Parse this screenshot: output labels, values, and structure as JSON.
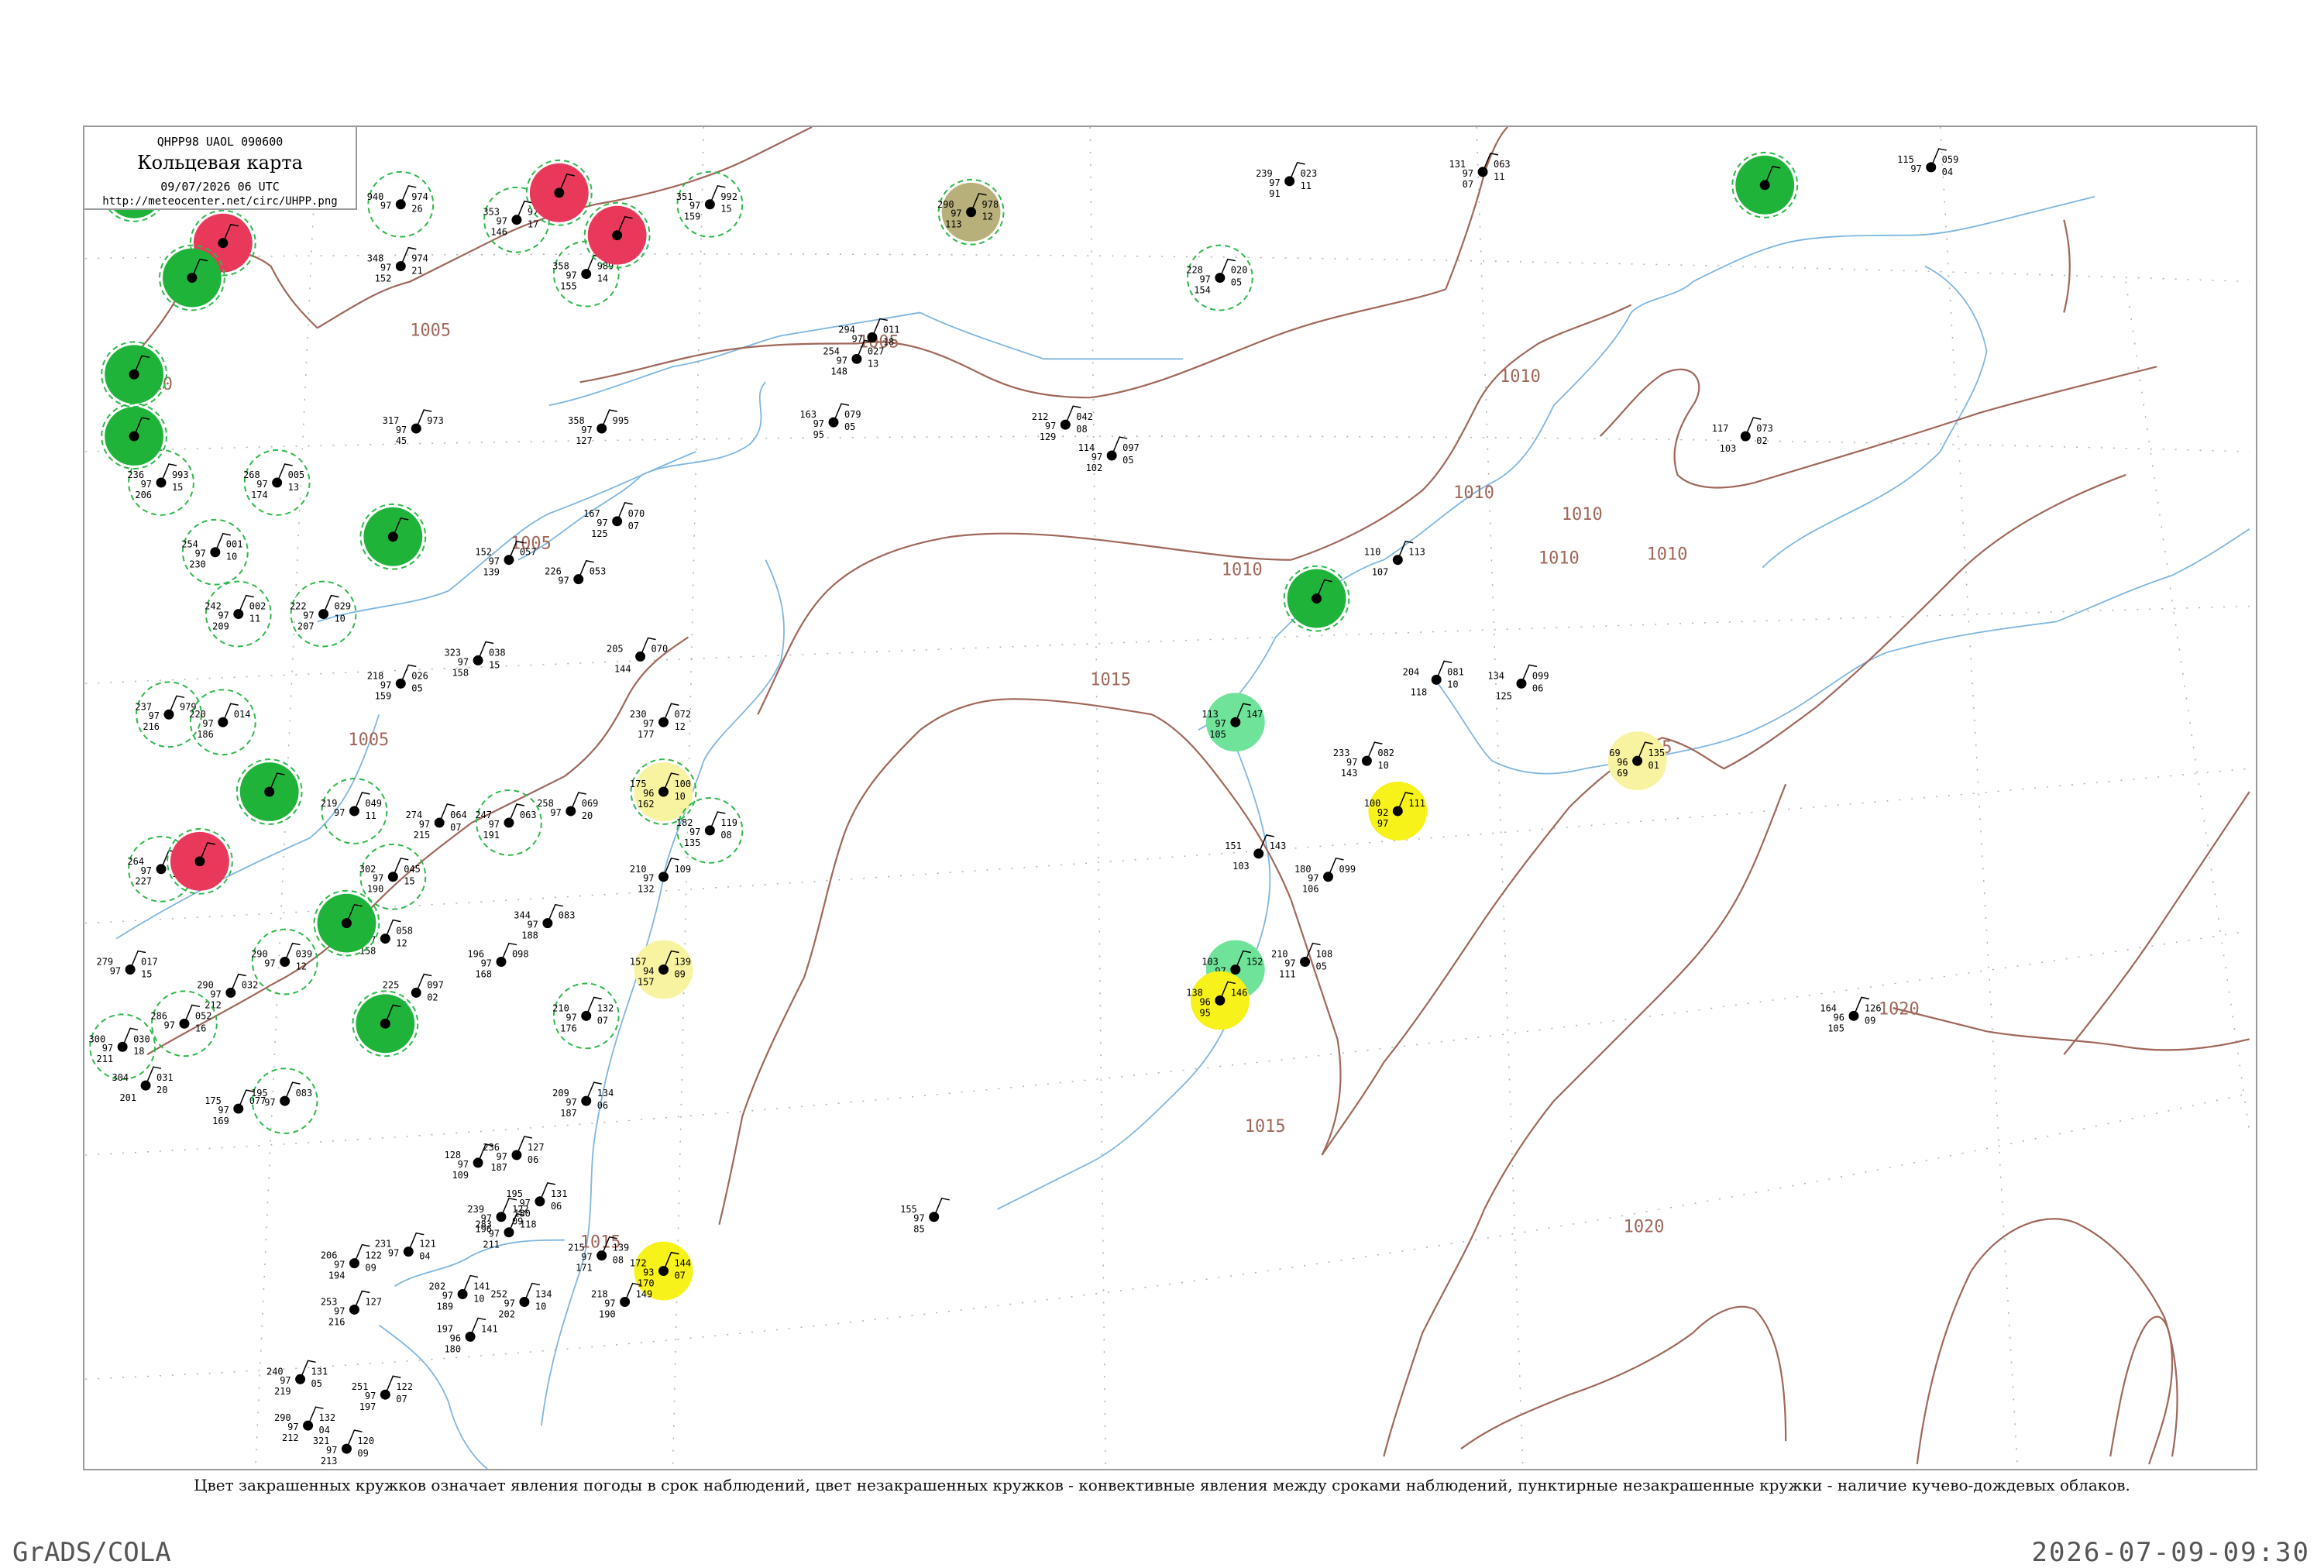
{
  "header": {
    "code": "QHPP98  UAOL  090600",
    "title": "Кольцевая карта",
    "time": "09/07/2026 06 UTC",
    "url": "http://meteocenter.net/circ/UHPP.png"
  },
  "caption": "Цвет закрашенных кружков означает явления погоды в срок наблюдений, цвет незакрашенных кружков - конвективные явления между сроками наблюдений, пунктирные незакрашенные кружки - наличие кучево-дождевых облаков.",
  "footer": {
    "left": "GrADS/COLA",
    "right": "2026-07-09-09:30"
  },
  "colors": {
    "isobar": "#a0675a",
    "coast": "#7fb6e0",
    "grid": "#b0b0b0",
    "green": "#1fb33a",
    "red": "#e8395a",
    "yellow": "#f7f21a",
    "paleyellow": "#f8f3a0",
    "lightgreen": "#6fe39a",
    "olive": "#b8b07a",
    "dashed": "#2fb84a"
  },
  "isobar_labels": [
    "1005",
    "1005",
    "1005",
    "1005",
    "1010",
    "1010",
    "1010",
    "1010",
    "1010",
    "1015",
    "1015",
    "1015",
    "1015",
    "1020",
    "1020",
    "1010",
    "1010"
  ],
  "stations": [
    {
      "id": "s1",
      "t": "940",
      "p": "974",
      "td": "97",
      "pt": "26",
      "l": "",
      "fill": "",
      "ring": "dashed"
    },
    {
      "id": "s2",
      "t": "353",
      "p": "977",
      "td": "97",
      "pt": "17",
      "l": "146",
      "fill": "",
      "ring": "dashed"
    },
    {
      "id": "s3",
      "t": "351",
      "p": "992",
      "td": "97",
      "pt": "15",
      "l": "159",
      "fill": "",
      "ring": "dashed"
    },
    {
      "id": "s4",
      "t": "290",
      "p": "978",
      "td": "97",
      "pt": "12",
      "l": "113",
      "fill": "olive",
      "ring": "dashed"
    },
    {
      "id": "s5",
      "t": "239",
      "p": "023",
      "td": "97",
      "pt": "11",
      "l": "91",
      "fill": "",
      "ring": ""
    },
    {
      "id": "s6",
      "t": "131",
      "p": "063",
      "td": "97",
      "pt": "11",
      "l": "07",
      "fill": "",
      "ring": ""
    },
    {
      "id": "s7",
      "t": "115",
      "p": "059",
      "td": "97",
      "pt": "04",
      "l": "",
      "fill": "",
      "ring": ""
    },
    {
      "id": "s8",
      "t": "348",
      "p": "974",
      "td": "97",
      "pt": "21",
      "l": "152",
      "fill": "",
      "ring": ""
    },
    {
      "id": "s9",
      "t": "358",
      "p": "989",
      "td": "97",
      "pt": "14",
      "l": "155",
      "fill": "",
      "ring": "dashed"
    },
    {
      "id": "s10",
      "t": "228",
      "p": "020",
      "td": "97",
      "pt": "05",
      "l": "154",
      "fill": "",
      "ring": "dashed"
    },
    {
      "id": "s11",
      "t": "294",
      "p": "011",
      "td": "97",
      "pt": "18",
      "l": "",
      "fill": "",
      "ring": ""
    },
    {
      "id": "s12",
      "t": "254",
      "p": "027",
      "td": "97",
      "pt": "13",
      "l": "148",
      "fill": "",
      "ring": ""
    },
    {
      "id": "s13",
      "t": "163",
      "p": "079",
      "td": "97",
      "pt": "05",
      "l": "95",
      "fill": "",
      "ring": ""
    },
    {
      "id": "s14",
      "t": "212",
      "p": "042",
      "td": "97",
      "pt": "08",
      "l": "129",
      "fill": "",
      "ring": ""
    },
    {
      "id": "s15",
      "t": "114",
      "p": "097",
      "td": "97",
      "pt": "05",
      "l": "102",
      "fill": "",
      "ring": ""
    },
    {
      "id": "s16",
      "t": "317",
      "p": "973",
      "td": "97",
      "pt": "",
      "l": "45",
      "fill": "",
      "ring": ""
    },
    {
      "id": "s17",
      "t": "358",
      "p": "995",
      "td": "97",
      "pt": "",
      "l": "127",
      "fill": "",
      "ring": ""
    },
    {
      "id": "s18",
      "t": "117",
      "p": "073",
      "td": "",
      "pt": "02",
      "l": "103",
      "fill": "",
      "ring": ""
    },
    {
      "id": "s19",
      "t": "236",
      "p": "993",
      "td": "97",
      "pt": "15",
      "l": "206",
      "fill": "",
      "ring": "dashed"
    },
    {
      "id": "s20",
      "t": "268",
      "p": "005",
      "td": "97",
      "pt": "13",
      "l": "174",
      "fill": "",
      "ring": "dashed"
    },
    {
      "id": "s21",
      "t": "167",
      "p": "070",
      "td": "97",
      "pt": "07",
      "l": "125",
      "fill": "",
      "ring": ""
    },
    {
      "id": "s22",
      "t": "254",
      "p": "001",
      "td": "97",
      "pt": "10",
      "l": "230",
      "fill": "",
      "ring": "dashed"
    },
    {
      "id": "s23",
      "t": "152",
      "p": "057",
      "td": "97",
      "pt": "",
      "l": "139",
      "fill": "",
      "ring": ""
    },
    {
      "id": "s24",
      "t": "226",
      "p": "053",
      "td": "97",
      "pt": "",
      "l": "",
      "fill": "",
      "ring": ""
    },
    {
      "id": "s25",
      "t": "110",
      "p": "113",
      "td": "",
      "pt": "",
      "l": "107",
      "fill": "",
      "ring": ""
    },
    {
      "id": "s26",
      "t": "242",
      "p": "002",
      "td": "97",
      "pt": "11",
      "l": "209",
      "fill": "",
      "ring": "dashed"
    },
    {
      "id": "s27",
      "t": "222",
      "p": "029",
      "td": "97",
      "pt": "10",
      "l": "207",
      "fill": "",
      "ring": "dashed"
    },
    {
      "id": "s28",
      "t": "323",
      "p": "038",
      "td": "97",
      "pt": "15",
      "l": "158",
      "fill": "",
      "ring": ""
    },
    {
      "id": "s29",
      "t": "218",
      "p": "026",
      "td": "97",
      "pt": "05",
      "l": "159",
      "fill": "",
      "ring": ""
    },
    {
      "id": "s30",
      "t": "205",
      "p": "070",
      "td": "",
      "pt": "",
      "l": "144",
      "fill": "",
      "ring": ""
    },
    {
      "id": "s31",
      "t": "204",
      "p": "081",
      "td": "",
      "pt": "10",
      "l": "118",
      "fill": "",
      "ring": ""
    },
    {
      "id": "s32",
      "t": "134",
      "p": "099",
      "td": "",
      "pt": "06",
      "l": "125",
      "fill": "",
      "ring": ""
    },
    {
      "id": "s33",
      "t": "113",
      "p": "147",
      "td": "97",
      "pt": "",
      "l": "105",
      "fill": "lightgreen",
      "ring": ""
    },
    {
      "id": "s34",
      "t": "237",
      "p": "979",
      "td": "97",
      "pt": "",
      "l": "216",
      "fill": "",
      "ring": "dashed"
    },
    {
      "id": "s35",
      "t": "220",
      "p": "014",
      "td": "97",
      "pt": "",
      "l": "186",
      "fill": "",
      "ring": "dashed"
    },
    {
      "id": "s36",
      "t": "230",
      "p": "072",
      "td": "97",
      "pt": "12",
      "l": "177",
      "fill": "",
      "ring": ""
    },
    {
      "id": "s37",
      "t": "233",
      "p": "082",
      "td": "97",
      "pt": "10",
      "l": "143",
      "fill": "",
      "ring": ""
    },
    {
      "id": "s38",
      "t": "69",
      "p": "135",
      "td": "96",
      "pt": "01",
      "l": "69",
      "fill": "paleyellow",
      "ring": ""
    },
    {
      "id": "s39",
      "t": "175",
      "p": "100",
      "td": "96",
      "pt": "10",
      "l": "162",
      "fill": "paleyellow",
      "ring": "dashed"
    },
    {
      "id": "s40",
      "t": "100",
      "p": "111",
      "td": "92",
      "pt": "",
      "l": "97",
      "fill": "yellow",
      "ring": ""
    },
    {
      "id": "s41",
      "t": "182",
      "p": "119",
      "td": "97",
      "pt": "08",
      "l": "135",
      "fill": "",
      "ring": "dashed"
    },
    {
      "id": "s42",
      "t": "219",
      "p": "049",
      "td": "97",
      "pt": "11",
      "l": "",
      "fill": "",
      "ring": "dashed"
    },
    {
      "id": "s43",
      "t": "274",
      "p": "064",
      "td": "97",
      "pt": "07",
      "l": "215",
      "fill": "",
      "ring": ""
    },
    {
      "id": "s44",
      "t": "247",
      "p": "063",
      "td": "97",
      "pt": "",
      "l": "191",
      "fill": "",
      "ring": "dashed"
    },
    {
      "id": "s45",
      "t": "258",
      "p": "069",
      "td": "97",
      "pt": "20",
      "l": "",
      "fill": "",
      "ring": ""
    },
    {
      "id": "s46",
      "t": "264",
      "p": "005",
      "td": "97",
      "pt": "15",
      "l": "227",
      "fill": "",
      "ring": "dashed"
    },
    {
      "id": "s47",
      "t": "302",
      "p": "045",
      "td": "97",
      "pt": "15",
      "l": "190",
      "fill": "",
      "ring": "dashed"
    },
    {
      "id": "s48",
      "t": "210",
      "p": "109",
      "td": "97",
      "pt": "",
      "l": "132",
      "fill": "",
      "ring": ""
    },
    {
      "id": "s49",
      "t": "180",
      "p": "099",
      "td": "97",
      "pt": "",
      "l": "106",
      "fill": "",
      "ring": ""
    },
    {
      "id": "s50",
      "t": "344",
      "p": "083",
      "td": "97",
      "pt": "",
      "l": "188",
      "fill": "",
      "ring": ""
    },
    {
      "id": "s51",
      "t": "196",
      "p": "098",
      "td": "97",
      "pt": "",
      "l": "168",
      "fill": "",
      "ring": ""
    },
    {
      "id": "s52",
      "t": "290",
      "p": "039",
      "td": "97",
      "pt": "12",
      "l": "",
      "fill": "",
      "ring": "dashed"
    },
    {
      "id": "s53",
      "t": "261",
      "p": "058",
      "td": "97",
      "pt": "12",
      "l": "158",
      "fill": "",
      "ring": ""
    },
    {
      "id": "s54",
      "t": "210",
      "p": "108",
      "td": "97",
      "pt": "05",
      "l": "111",
      "fill": "",
      "ring": ""
    },
    {
      "id": "s55",
      "t": "157",
      "p": "139",
      "td": "94",
      "pt": "09",
      "l": "157",
      "fill": "paleyellow",
      "ring": ""
    },
    {
      "id": "s56",
      "t": "103",
      "p": "152",
      "td": "97",
      "pt": "",
      "l": "100",
      "fill": "lightgreen",
      "ring": ""
    },
    {
      "id": "s57",
      "t": "138",
      "p": "146",
      "td": "96",
      "pt": "",
      "l": "95",
      "fill": "yellow",
      "ring": ""
    },
    {
      "id": "s58",
      "t": "164",
      "p": "126",
      "td": "96",
      "pt": "09",
      "l": "105",
      "fill": "",
      "ring": ""
    },
    {
      "id": "s59",
      "t": "279",
      "p": "017",
      "td": "97",
      "pt": "15",
      "l": "",
      "fill": "",
      "ring": ""
    },
    {
      "id": "s60",
      "t": "290",
      "p": "032",
      "td": "97",
      "pt": "",
      "l": "212",
      "fill": "",
      "ring": ""
    },
    {
      "id": "s61",
      "t": "286",
      "p": "052",
      "td": "97",
      "pt": "16",
      "l": "",
      "fill": "",
      "ring": "dashed"
    },
    {
      "id": "s62",
      "t": "225",
      "p": "097",
      "td": "",
      "pt": "02",
      "l": "185",
      "fill": "",
      "ring": ""
    },
    {
      "id": "s63",
      "t": "210",
      "p": "132",
      "td": "97",
      "pt": "07",
      "l": "176",
      "fill": "",
      "ring": "dashed"
    },
    {
      "id": "s64",
      "t": "300",
      "p": "030",
      "td": "97",
      "pt": "18",
      "l": "211",
      "fill": "",
      "ring": "dashed"
    },
    {
      "id": "s65",
      "t": "304",
      "p": "031",
      "td": "",
      "pt": "20",
      "l": "201",
      "fill": "",
      "ring": ""
    },
    {
      "id": "s66",
      "t": "175",
      "p": "077",
      "td": "97",
      "pt": "",
      "l": "169",
      "fill": "",
      "ring": ""
    },
    {
      "id": "s67",
      "t": "195",
      "p": "083",
      "td": "97",
      "pt": "",
      "l": "",
      "fill": "",
      "ring": "dashed"
    },
    {
      "id": "s68",
      "t": "209",
      "p": "134",
      "td": "97",
      "pt": "06",
      "l": "187",
      "fill": "",
      "ring": ""
    },
    {
      "id": "s69",
      "t": "128",
      "p": "",
      "td": "97",
      "pt": "",
      "l": "109",
      "fill": "",
      "ring": ""
    },
    {
      "id": "s70",
      "t": "236",
      "p": "127",
      "td": "97",
      "pt": "06",
      "l": "187",
      "fill": "",
      "ring": ""
    },
    {
      "id": "s71",
      "t": "195",
      "p": "131",
      "td": "97",
      "pt": "06",
      "l": "180",
      "fill": "",
      "ring": ""
    },
    {
      "id": "s72",
      "t": "239",
      "p": "122",
      "td": "97",
      "pt": "09",
      "l": "196",
      "fill": "",
      "ring": ""
    },
    {
      "id": "s73",
      "t": "283",
      "p": "118",
      "td": "97",
      "pt": "",
      "l": "211",
      "fill": "",
      "ring": ""
    },
    {
      "id": "s74",
      "t": "155",
      "p": "",
      "td": "97",
      "pt": "",
      "l": "85",
      "fill": "",
      "ring": ""
    },
    {
      "id": "s75",
      "t": "215",
      "p": "139",
      "td": "97",
      "pt": "08",
      "l": "171",
      "fill": "",
      "ring": ""
    },
    {
      "id": "s76",
      "t": "172",
      "p": "144",
      "td": "93",
      "pt": "07",
      "l": "170",
      "fill": "yellow",
      "ring": ""
    },
    {
      "id": "s77",
      "t": "218",
      "p": "149",
      "td": "97",
      "pt": "",
      "l": "190",
      "fill": "",
      "ring": ""
    },
    {
      "id": "s78",
      "t": "206",
      "p": "122",
      "td": "97",
      "pt": "09",
      "l": "194",
      "fill": "",
      "ring": ""
    },
    {
      "id": "s79",
      "t": "231",
      "p": "121",
      "td": "97",
      "pt": "04",
      "l": "",
      "fill": "",
      "ring": ""
    },
    {
      "id": "s80",
      "t": "202",
      "p": "141",
      "td": "97",
      "pt": "10",
      "l": "189",
      "fill": "",
      "ring": ""
    },
    {
      "id": "s81",
      "t": "252",
      "p": "134",
      "td": "97",
      "pt": "10",
      "l": "202",
      "fill": "",
      "ring": ""
    },
    {
      "id": "s82",
      "t": "253",
      "p": "127",
      "td": "97",
      "pt": "",
      "l": "216",
      "fill": "",
      "ring": ""
    },
    {
      "id": "s83",
      "t": "240",
      "p": "131",
      "td": "97",
      "pt": "05",
      "l": "219",
      "fill": "",
      "ring": ""
    },
    {
      "id": "s84",
      "t": "251",
      "p": "122",
      "td": "97",
      "pt": "07",
      "l": "197",
      "fill": "",
      "ring": ""
    },
    {
      "id": "s85",
      "t": "290",
      "p": "132",
      "td": "97",
      "pt": "04",
      "l": "212",
      "fill": "",
      "ring": ""
    },
    {
      "id": "s86",
      "t": "321",
      "p": "120",
      "td": "97",
      "pt": "09",
      "l": "213",
      "fill": "",
      "ring": ""
    },
    {
      "id": "s87",
      "t": "151",
      "p": "143",
      "td": "",
      "pt": "",
      "l": "103",
      "fill": "",
      "ring": ""
    },
    {
      "id": "s88",
      "t": "197",
      "p": "141",
      "td": "96",
      "pt": "",
      "l": "180",
      "fill": "",
      "ring": ""
    },
    {
      "id": "g1",
      "t": "",
      "p": "",
      "td": "",
      "pt": "",
      "l": "",
      "fill": "green",
      "ring": "dashed"
    },
    {
      "id": "g2",
      "t": "",
      "p": "",
      "td": "",
      "pt": "",
      "l": "",
      "fill": "red",
      "ring": "dashed"
    },
    {
      "id": "g3",
      "t": "",
      "p": "",
      "td": "",
      "pt": "",
      "l": "",
      "fill": "green",
      "ring": "dashed"
    },
    {
      "id": "g4",
      "t": "",
      "p": "",
      "td": "",
      "pt": "",
      "l": "",
      "fill": "red",
      "ring": "dashed"
    },
    {
      "id": "g5",
      "t": "",
      "p": "",
      "td": "",
      "pt": "",
      "l": "",
      "fill": "red",
      "ring": "dashed"
    },
    {
      "id": "g6",
      "t": "",
      "p": "",
      "td": "",
      "pt": "",
      "l": "",
      "fill": "green",
      "ring": "dashed"
    },
    {
      "id": "g7",
      "t": "",
      "p": "",
      "td": "",
      "pt": "",
      "l": "",
      "fill": "green",
      "ring": "dashed"
    },
    {
      "id": "g8",
      "t": "",
      "p": "",
      "td": "",
      "pt": "",
      "l": "",
      "fill": "green",
      "ring": "dashed"
    },
    {
      "id": "g9",
      "t": "",
      "p": "",
      "td": "",
      "pt": "",
      "l": "",
      "fill": "green",
      "ring": "dashed"
    },
    {
      "id": "g10",
      "t": "",
      "p": "",
      "td": "",
      "pt": "",
      "l": "",
      "fill": "green",
      "ring": "dashed"
    },
    {
      "id": "g11",
      "t": "",
      "p": "",
      "td": "",
      "pt": "",
      "l": "",
      "fill": "red",
      "ring": "dashed"
    },
    {
      "id": "g12",
      "t": "",
      "p": "",
      "td": "",
      "pt": "",
      "l": "",
      "fill": "green",
      "ring": "dashed"
    },
    {
      "id": "g13",
      "t": "",
      "p": "",
      "td": "",
      "pt": "",
      "l": "",
      "fill": "green",
      "ring": "dashed"
    },
    {
      "id": "g14",
      "t": "",
      "p": "",
      "td": "",
      "pt": "",
      "l": "",
      "fill": "green",
      "ring": "dashed"
    }
  ]
}
